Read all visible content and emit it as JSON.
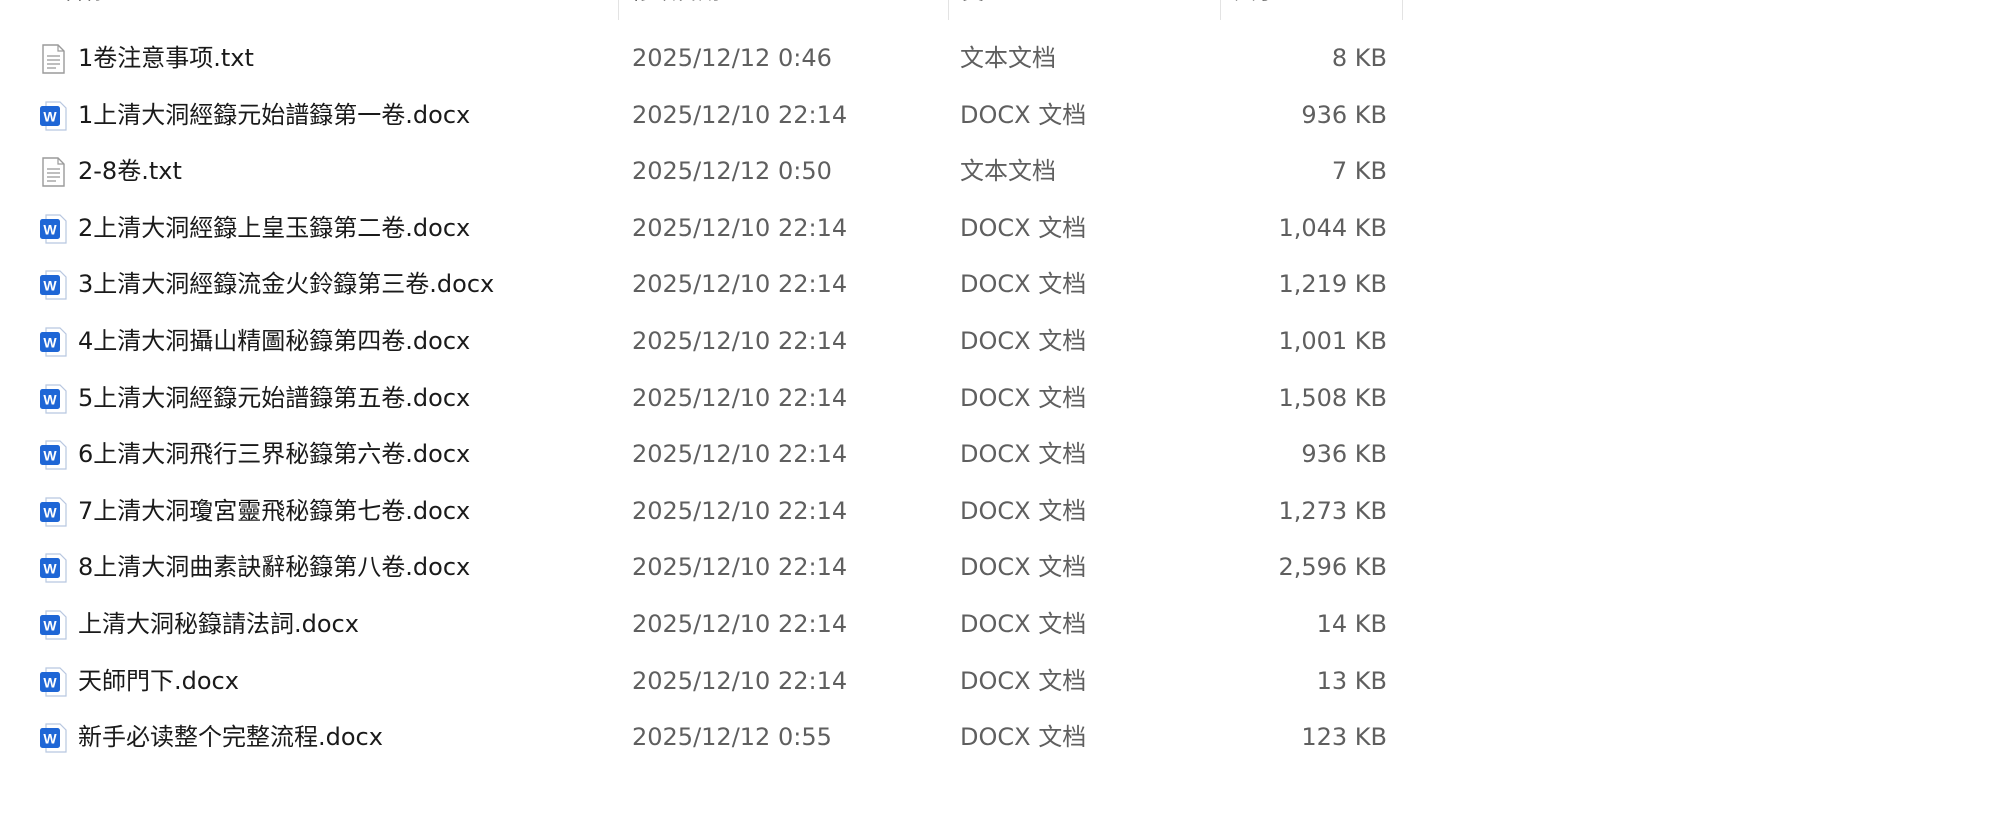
{
  "header": {
    "name_label": "名称",
    "date_label": "修改日期",
    "type_label": "类型",
    "size_label": "大小"
  },
  "files": [
    {
      "name": "1卷注意事项.txt",
      "date": "2025/12/12 0:46",
      "type": "文本文档",
      "size": "8 KB",
      "icon": "text-file-icon"
    },
    {
      "name": "1上清大洞經籙元始譜籙第一卷.docx",
      "date": "2025/12/10 22:14",
      "type": "DOCX 文档",
      "size": "936 KB",
      "icon": "word-doc-icon"
    },
    {
      "name": "2-8卷.txt",
      "date": "2025/12/12 0:50",
      "type": "文本文档",
      "size": "7 KB",
      "icon": "text-file-icon"
    },
    {
      "name": "2上清大洞經籙上皇玉籙第二卷.docx",
      "date": "2025/12/10 22:14",
      "type": "DOCX 文档",
      "size": "1,044 KB",
      "icon": "word-doc-icon"
    },
    {
      "name": "3上清大洞經籙流金火鈴籙第三卷.docx",
      "date": "2025/12/10 22:14",
      "type": "DOCX 文档",
      "size": "1,219 KB",
      "icon": "word-doc-icon"
    },
    {
      "name": "4上清大洞攝山精圖秘籙第四卷.docx",
      "date": "2025/12/10 22:14",
      "type": "DOCX 文档",
      "size": "1,001 KB",
      "icon": "word-doc-icon"
    },
    {
      "name": "5上清大洞經籙元始譜籙第五卷.docx",
      "date": "2025/12/10 22:14",
      "type": "DOCX 文档",
      "size": "1,508 KB",
      "icon": "word-doc-icon"
    },
    {
      "name": "6上清大洞飛行三界秘籙第六卷.docx",
      "date": "2025/12/10 22:14",
      "type": "DOCX 文档",
      "size": "936 KB",
      "icon": "word-doc-icon"
    },
    {
      "name": "7上清大洞瓊宮靈飛秘籙第七卷.docx",
      "date": "2025/12/10 22:14",
      "type": "DOCX 文档",
      "size": "1,273 KB",
      "icon": "word-doc-icon"
    },
    {
      "name": "8上清大洞曲素訣辭秘籙第八卷.docx",
      "date": "2025/12/10 22:14",
      "type": "DOCX 文档",
      "size": "2,596 KB",
      "icon": "word-doc-icon"
    },
    {
      "name": "上清大洞秘籙請法詞.docx",
      "date": "2025/12/10 22:14",
      "type": "DOCX 文档",
      "size": "14 KB",
      "icon": "word-doc-icon"
    },
    {
      "name": "天師門下.docx",
      "date": "2025/12/10 22:14",
      "type": "DOCX 文档",
      "size": "13 KB",
      "icon": "word-doc-icon"
    },
    {
      "name": "新手必读整个完整流程.docx",
      "date": "2025/12/12 0:55",
      "type": "DOCX 文档",
      "size": "123 KB",
      "icon": "word-doc-icon"
    }
  ],
  "colors": {
    "word_blue": "#1e66d6",
    "text_file_gray": "#9a9a9a",
    "secondary_text": "#5f5f5f"
  }
}
